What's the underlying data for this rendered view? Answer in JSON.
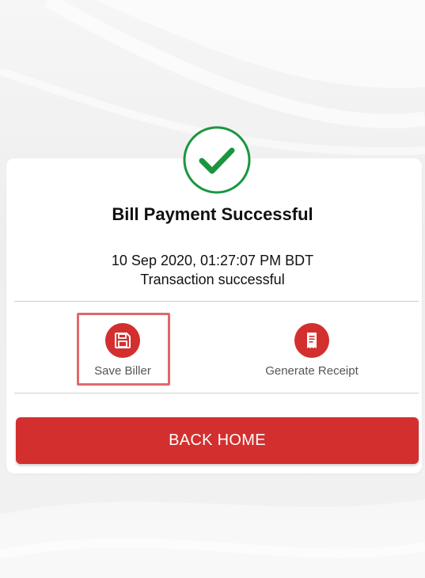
{
  "result": {
    "title": "Bill Payment Successful",
    "datetime": "10 Sep 2020, 01:27:07 PM BDT",
    "status": "Transaction successful",
    "icon": "check-circle-icon",
    "accent_color": "#1a9641"
  },
  "actions": {
    "save_biller": {
      "label": "Save Biller",
      "icon": "floppy-disk-icon"
    },
    "generate_receipt": {
      "label": "Generate Receipt",
      "icon": "receipt-icon"
    }
  },
  "back_home": {
    "label": "BACK HOME"
  },
  "colors": {
    "primary": "#d32f2f",
    "success": "#1a9641",
    "highlight": "#e2686a"
  }
}
